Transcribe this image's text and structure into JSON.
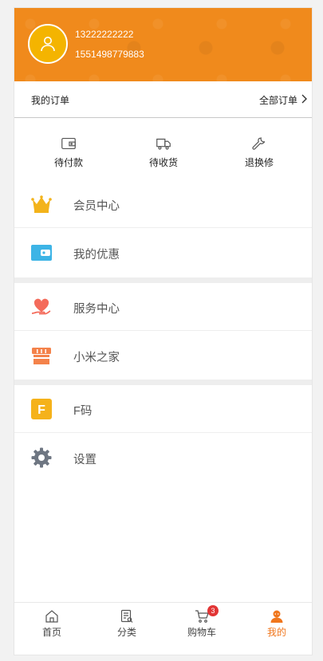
{
  "user": {
    "phone": "13222222222",
    "id": "1551498779883"
  },
  "orders": {
    "title": "我的订单",
    "all_label": "全部订单"
  },
  "order_status": [
    {
      "label": "待付款",
      "icon": "wallet-icon"
    },
    {
      "label": "待收货",
      "icon": "truck-icon"
    },
    {
      "label": "退换修",
      "icon": "wrench-icon"
    }
  ],
  "menu": [
    {
      "label": "会员中心",
      "icon": "crown-icon",
      "color": "#f3b31b"
    },
    {
      "label": "我的优惠",
      "icon": "wallet-card-icon",
      "color": "#3db4e6"
    },
    {
      "label": "服务中心",
      "icon": "heart-hand-icon",
      "color": "#f46b5b"
    },
    {
      "label": "小米之家",
      "icon": "store-icon",
      "color": "#f4824a"
    },
    {
      "label": "F码",
      "icon": "f-code-icon",
      "color": "#f5b21b",
      "glyph": "F"
    },
    {
      "label": "设置",
      "icon": "gear-icon",
      "color": "#6e7682"
    }
  ],
  "nav": [
    {
      "label": "首页",
      "icon": "home-icon"
    },
    {
      "label": "分类",
      "icon": "category-icon"
    },
    {
      "label": "购物车",
      "icon": "cart-icon",
      "badge": "3"
    },
    {
      "label": "我的",
      "icon": "user-icon",
      "active": true
    }
  ],
  "colors": {
    "header": "#f08a1c",
    "accent": "#f0761c",
    "badge": "#e23535"
  }
}
